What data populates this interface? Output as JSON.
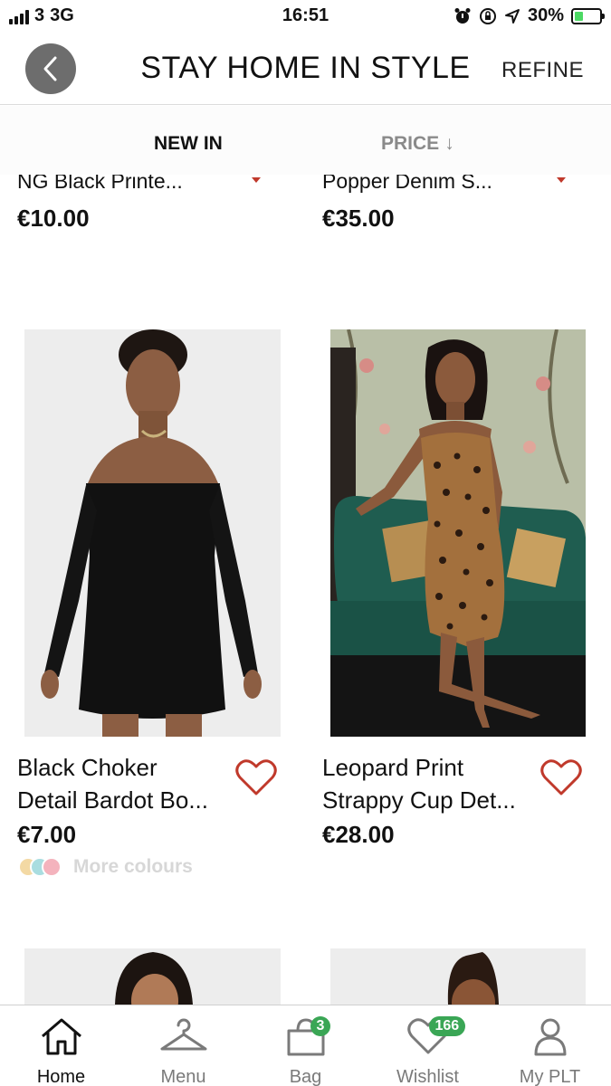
{
  "status_bar": {
    "carrier": "3",
    "network": "3G",
    "time": "16:51",
    "battery": "30%"
  },
  "header": {
    "title": "STAY HOME IN STYLE",
    "refine": "REFINE"
  },
  "sort": {
    "new_in": "NEW IN",
    "price": "PRICE",
    "price_arrow": "↓"
  },
  "products_top": [
    {
      "name": "NG Black Printe...",
      "price": "€10.00"
    },
    {
      "name": "Popper Denim S...",
      "price": "€35.00"
    }
  ],
  "products": [
    {
      "name_line1": "Black Choker",
      "name_line2": "Detail Bardot Bo...",
      "price": "€7.00",
      "more_colours": "More colours",
      "swatches": [
        "#f3d9a4",
        "#a9dde0",
        "#f4b3bd"
      ]
    },
    {
      "name_line1": "Leopard Print",
      "name_line2": "Strappy Cup Det...",
      "price": "€28.00"
    }
  ],
  "tabs": [
    {
      "label": "Home",
      "icon": "home-icon"
    },
    {
      "label": "Menu",
      "icon": "hanger-icon"
    },
    {
      "label": "Bag",
      "icon": "bag-icon",
      "badge": "3"
    },
    {
      "label": "Wishlist",
      "icon": "heart-icon",
      "badge": "166"
    },
    {
      "label": "My PLT",
      "icon": "user-icon"
    }
  ],
  "colors": {
    "accent_red": "#c0392b",
    "badge_green": "#3aa655",
    "back_button": "#6d6d6d"
  }
}
